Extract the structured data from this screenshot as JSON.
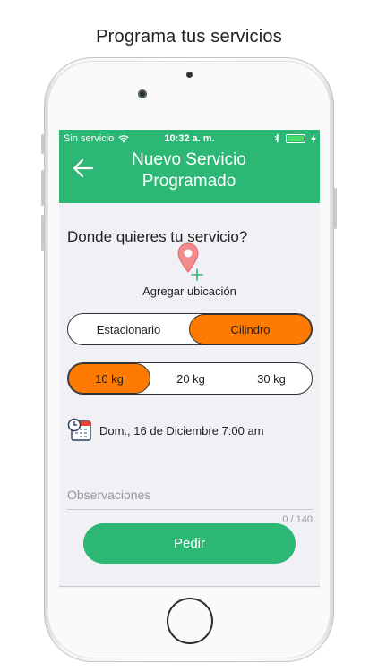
{
  "caption": "Programa tus servicios",
  "status": {
    "carrier": "Sin servicio",
    "time": "10:32 a. m.",
    "bluetooth_icon": "bluetooth-icon",
    "battery_color": "#4cd964"
  },
  "navbar": {
    "back_icon": "arrow-left-icon",
    "title": "Nuevo Servicio Programado",
    "color": "#2db775"
  },
  "location": {
    "question": "Donde quieres tu servicio?",
    "pin_icon": "map-pin-plus-icon",
    "add_label": "Agregar ubicación"
  },
  "type_selector": {
    "options": [
      "Estacionario",
      "Cilindro"
    ],
    "selected": "Cilindro"
  },
  "size_selector": {
    "options": [
      "10 kg",
      "20 kg",
      "30 kg"
    ],
    "selected": "10 kg"
  },
  "schedule": {
    "calendar_icon": "calendar-clock-icon",
    "datetime": "Dom., 16 de Diciembre 7:00 am"
  },
  "observations": {
    "placeholder": "Observaciones",
    "counter": "0 / 140"
  },
  "submit_label": "Pedir",
  "accent_color": "#fe7a00"
}
